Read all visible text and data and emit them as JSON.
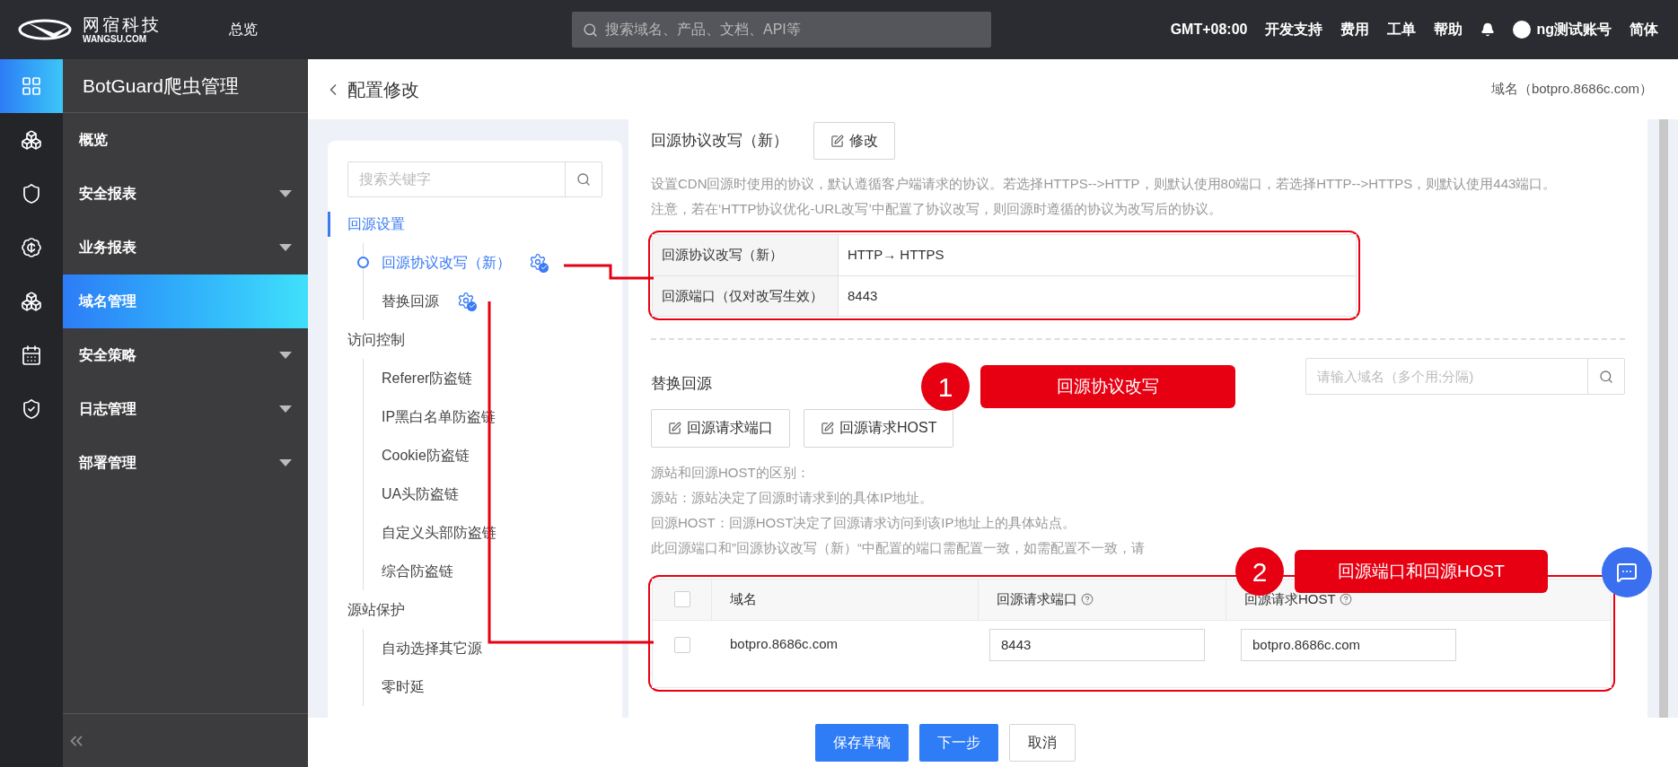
{
  "header": {
    "logo": "网宿科技",
    "logo_sub": "WANGSU.COM",
    "nav": "总览",
    "search_placeholder": "搜索域名、产品、文档、API等",
    "links": [
      "GMT+08:00",
      "开发支持",
      "费用",
      "工单",
      "帮助"
    ],
    "user": "ng测试账号",
    "language": "简体"
  },
  "rail": [
    {
      "kind": "grid",
      "selected": true
    },
    {
      "kind": "cluster",
      "selected": false
    },
    {
      "kind": "shield",
      "selected": false
    },
    {
      "kind": "badge",
      "selected": false
    },
    {
      "kind": "cluster",
      "selected": false
    },
    {
      "kind": "calendar",
      "selected": false
    },
    {
      "kind": "shield-filled",
      "selected": false
    }
  ],
  "sidebar": {
    "title": "BotGuard爬虫管理",
    "items": [
      {
        "label": "概览",
        "expandable": false,
        "selected": false
      },
      {
        "label": "安全报表",
        "expandable": true,
        "selected": false
      },
      {
        "label": "业务报表",
        "expandable": true,
        "selected": false
      },
      {
        "label": "域名管理",
        "expandable": false,
        "selected": true
      },
      {
        "label": "安全策略",
        "expandable": true,
        "selected": false
      },
      {
        "label": "日志管理",
        "expandable": true,
        "selected": false
      },
      {
        "label": "部署管理",
        "expandable": true,
        "selected": false
      }
    ]
  },
  "page": {
    "title": "配置修改",
    "domain": "域名（botpro.8686c.com）"
  },
  "tree": {
    "search_placeholder": "搜索关键字",
    "groups": [
      {
        "label": "回源设置",
        "selected": true,
        "children": [
          {
            "label": "回源协议改写（新）",
            "selected": true,
            "configured": true
          },
          {
            "label": "替换回源",
            "selected": false,
            "configured": true
          }
        ]
      },
      {
        "label": "访问控制",
        "selected": false,
        "children": [
          {
            "label": "Referer防盗链",
            "selected": false,
            "configured": false
          },
          {
            "label": "IP黑白名单防盗链",
            "selected": false,
            "configured": false
          },
          {
            "label": "Cookie防盗链",
            "selected": false,
            "configured": false
          },
          {
            "label": "UA头防盗链",
            "selected": false,
            "configured": false
          },
          {
            "label": "自定义头部防盗链",
            "selected": false,
            "configured": false
          },
          {
            "label": "综合防盗链",
            "selected": false,
            "configured": false
          }
        ]
      },
      {
        "label": "源站保护",
        "selected": false,
        "children": [
          {
            "label": "自动选择其它源",
            "selected": false,
            "configured": false
          },
          {
            "label": "零时延",
            "selected": false,
            "configured": false
          }
        ]
      }
    ]
  },
  "protocol_section": {
    "title": "回源协议改写（新）",
    "edit_button": "修改",
    "description": "设置CDN回源时使用的协议，默认遵循客户端请求的协议。若选择HTTPS-->HTTP，则默认使用80端口，若选择HTTP-->HTTPS，则默认使用443端口。",
    "note": "注意，若在‘HTTP协议优化-URL改写’中配置了协议改写，则回源时遵循的协议为改写后的协议。",
    "rows": [
      {
        "label": "回源协议改写（新）",
        "value": "HTTP→ HTTPS"
      },
      {
        "label": "回源端口（仅对改写生效）",
        "value": "8443"
      }
    ]
  },
  "origin_section": {
    "title": "替换回源",
    "search_placeholder": "请输入域名（多个用;分隔)",
    "buttons": [
      "回源请求端口",
      "回源请求HOST"
    ],
    "notes": [
      "源站和回源HOST的区别：",
      "源站：源站决定了回源时请求到的具体IP地址。",
      "回源HOST：回源HOST决定了回源请求访问到该IP地址上的具体站点。",
      "此回源端口和”回源协议改写（新）“中配置的端口需配置一致，如需配置不一致，请"
    ],
    "header_checked": false,
    "columns": [
      {
        "label": "域名",
        "help": false
      },
      {
        "label": "回源请求端口",
        "help": true
      },
      {
        "label": "回源请求HOST",
        "help": true
      }
    ],
    "rows": [
      {
        "checked": false,
        "domain": "botpro.8686c.com",
        "port": "8443",
        "host": "botpro.8686c.com"
      }
    ]
  },
  "annotations": [
    {
      "number": "1",
      "label": "回源协议改写"
    },
    {
      "number": "2",
      "label": "回源端口和回源HOST"
    }
  ],
  "footer_buttons": [
    {
      "label": "保存草稿",
      "kind": "primary"
    },
    {
      "label": "下一步",
      "kind": "primary"
    },
    {
      "label": "取消",
      "kind": "default"
    }
  ]
}
